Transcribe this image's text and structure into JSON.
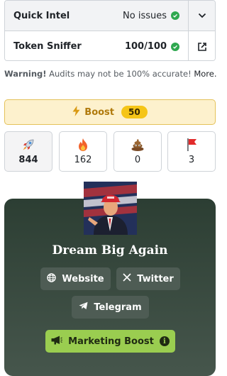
{
  "audits": [
    {
      "label": "Quick Intel",
      "value": "No issues",
      "status": "pass",
      "action_icon": "chevron-down-icon"
    },
    {
      "label": "Token Sniffer",
      "value": "100/100",
      "status": "pass",
      "action_icon": "external-link-icon"
    }
  ],
  "warning": {
    "strong": "Warning!",
    "text": " Audits may not be 100% accurate! ",
    "more": "More."
  },
  "boost": {
    "label": "Boost",
    "count": "50"
  },
  "reactions": [
    {
      "icon": "rocket-icon",
      "count": "844",
      "active": true
    },
    {
      "icon": "fire-icon",
      "count": "162",
      "active": false
    },
    {
      "icon": "poop-icon",
      "count": "0",
      "active": false
    },
    {
      "icon": "red-flag-icon",
      "count": "3",
      "active": false
    }
  ],
  "token": {
    "name": "Dream Big Again",
    "links": [
      {
        "label": "Website",
        "icon": "globe-icon"
      },
      {
        "label": "Twitter",
        "icon": "x-logo-icon"
      },
      {
        "label": "Telegram",
        "icon": "telegram-icon"
      }
    ],
    "marketing_label": "Marketing Boost"
  },
  "colors": {
    "pass": "#2fa84f",
    "boost_bg": "#fdf1cd",
    "boost_text": "#b07a0c",
    "card_bg": "#2c3e33",
    "marketing_bg": "#9acd50"
  }
}
